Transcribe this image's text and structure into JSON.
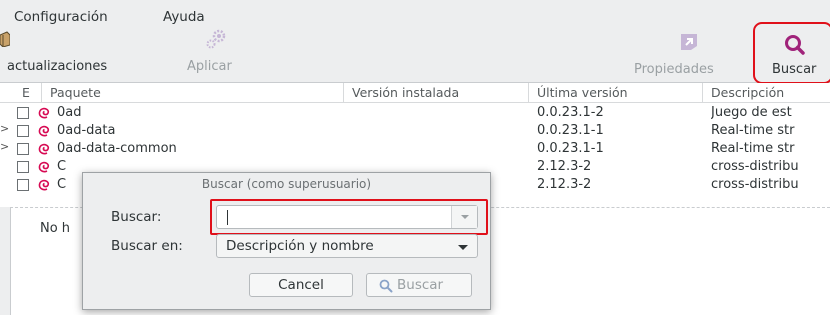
{
  "menu": {
    "items": [
      "Configuración",
      "Ayuda"
    ]
  },
  "toolbar": {
    "updates_label": "actualizaciones",
    "apply_label": "Aplicar",
    "properties_label": "Propiedades",
    "search_label": "Buscar"
  },
  "table": {
    "columns": [
      "E",
      "Paquete",
      "Versión instalada",
      "Última versión",
      "Descripción"
    ],
    "rows": [
      {
        "left_mark": "",
        "package": "0ad",
        "installed": "",
        "latest": "0.0.23.1-2",
        "description": "Juego de est"
      },
      {
        "left_mark": ">",
        "package": "0ad-data",
        "installed": "",
        "latest": "0.0.23.1-1",
        "description": "Real-time str"
      },
      {
        "left_mark": ">",
        "package": "0ad-data-common",
        "installed": "",
        "latest": "0.0.23.1-1",
        "description": "Real-time str"
      },
      {
        "left_mark": "",
        "package": "C",
        "installed": "",
        "latest": "2.12.3-2",
        "description": "cross-distribu"
      },
      {
        "left_mark": "",
        "package": "C",
        "installed": "",
        "latest": "2.12.3-2",
        "description": "cross-distribu"
      }
    ]
  },
  "lower_pane": {
    "text": "No h"
  },
  "dialog": {
    "title": "Buscar (como superusuario)",
    "search_label": "Buscar:",
    "search_value": "",
    "search_in_label": "Buscar en:",
    "search_in_value": "Descripción y nombre",
    "cancel_label": "Cancel",
    "search_button_label": "Buscar"
  },
  "colors": {
    "highlight": "#e0101a",
    "accent": "#a0237a",
    "debian": "#d70a53"
  }
}
